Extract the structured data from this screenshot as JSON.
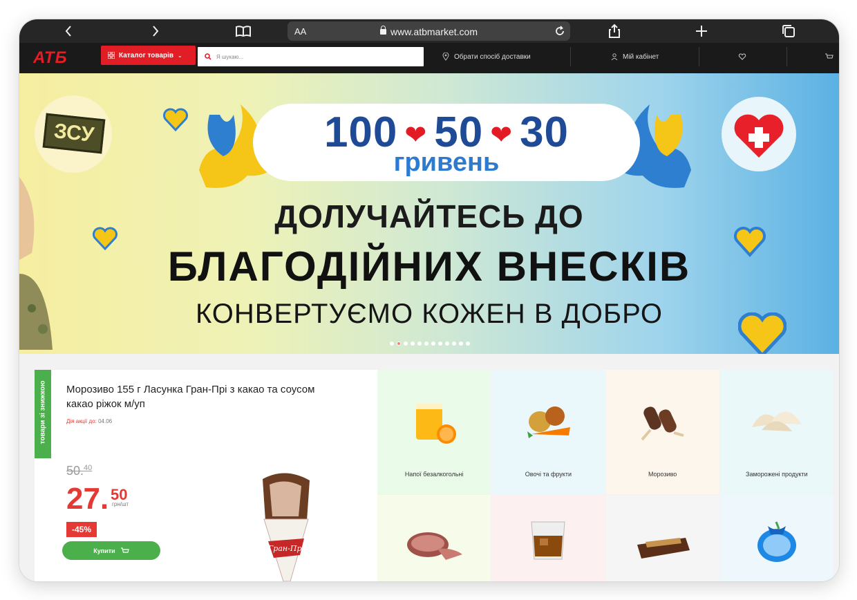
{
  "browser": {
    "url": "www.atbmarket.com",
    "text_size_label": "AA"
  },
  "header": {
    "logo": "АТБ",
    "catalog_label": "Каталог товарів",
    "search_placeholder": "Я шукаю...",
    "delivery_label": "Обрати спосіб доставки",
    "account_label": "Мій кабінет"
  },
  "banner": {
    "amounts": [
      "100",
      "50",
      "30"
    ],
    "currency": "гривень",
    "line1": "ДОЛУЧАЙТЕСЬ ДО",
    "line2": "БЛАГОДІЙНИХ ВНЕСКІВ",
    "line3": "КОНВЕРТУЄМО КОЖЕН В ДОБРО",
    "badge_text": "ЗСУ",
    "slides_total": 12,
    "active_slide": 2
  },
  "promo": {
    "ribbon": "товари зі знижкою",
    "title": "Морозиво 155 г Ласунка Гран-Прі з какао та соусом какао ріжок м/уп",
    "date_label": "Дія акції до:",
    "date_value": "04.06",
    "old_price_main": "50.",
    "old_price_cents": "40",
    "price_main": "27.",
    "price_cents": "50",
    "unit": "грн/шт",
    "discount": "-45%",
    "buy_label": "Купити",
    "product_wrapper_text": "Гран-Прі"
  },
  "categories": [
    {
      "label": "Напої безалкогольні",
      "icon": "juice-icon"
    },
    {
      "label": "Овочі та фрукти",
      "icon": "vegetables-icon"
    },
    {
      "label": "Морозиво",
      "icon": "ice-cream-icon"
    },
    {
      "label": "Заморожені продукти",
      "icon": "dumplings-icon"
    },
    {
      "label": "",
      "icon": "ham-icon"
    },
    {
      "label": "",
      "icon": "whisky-glass-icon"
    },
    {
      "label": "",
      "icon": "chocolate-bar-icon"
    },
    {
      "label": "",
      "icon": "blue-package-icon"
    }
  ],
  "colors": {
    "brand_red": "#e11e26",
    "header_bg": "#1a1a1a",
    "accent_green": "#4bb04b",
    "price_red": "#e53935"
  }
}
